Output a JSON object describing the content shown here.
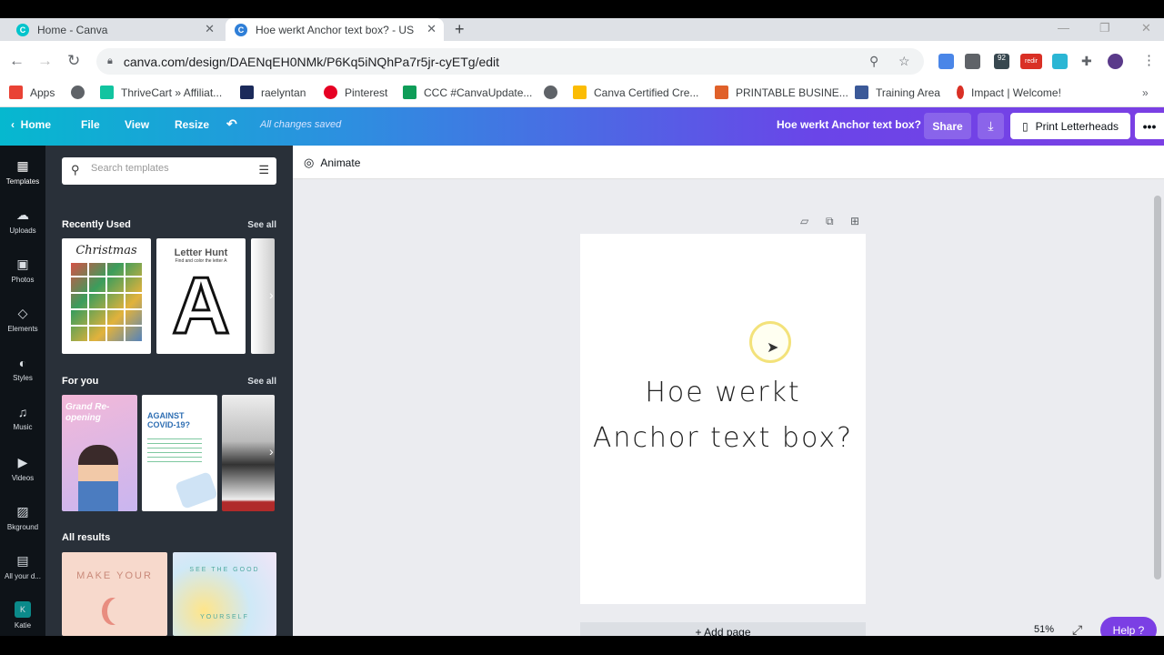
{
  "browser": {
    "tabs": [
      {
        "label": "Home - Canva",
        "active": false
      },
      {
        "label": "Hoe werkt Anchor text box? - US",
        "active": true
      }
    ],
    "url": "canva.com/design/DAENqEH0NMk/P6Kq5iNQhPa7r5jr-cyETg/edit",
    "ext_badge": "92",
    "ext_redir": "redir"
  },
  "bookmarks": [
    {
      "label": "Apps",
      "icon": "apps-grid-icon",
      "color": "#e94235"
    },
    {
      "label": "",
      "icon": "globe-icon",
      "color": "#5f6368"
    },
    {
      "label": "ThriveCart » Affiliat...",
      "icon": "thrivecart-icon",
      "color": "#12c4a0"
    },
    {
      "label": "raelyntan",
      "icon": "raelyntan-icon",
      "color": "#1b2a5a"
    },
    {
      "label": "Pinterest",
      "icon": "pinterest-icon",
      "color": "#e60023"
    },
    {
      "label": "CCC #CanvaUpdate...",
      "icon": "sheets-icon",
      "color": "#0f9d58"
    },
    {
      "label": "",
      "icon": "globe-icon",
      "color": "#5f6368"
    },
    {
      "label": "Canva Certified Cre...",
      "icon": "drive-icon",
      "color": "#fbbc04"
    },
    {
      "label": "PRINTABLE BUSINE...",
      "icon": "printable-icon",
      "color": "#e0612a"
    },
    {
      "label": "Training Area",
      "icon": "training-icon",
      "color": "#3b5998"
    },
    {
      "label": "Impact | Welcome!",
      "icon": "impact-icon",
      "color": "#d93025"
    }
  ],
  "canva_top": {
    "home": "Home",
    "file": "File",
    "view": "View",
    "resize": "Resize",
    "saved": "All changes saved",
    "design_title": "Hoe werkt Anchor text box?",
    "share": "Share",
    "print": "Print Letterheads",
    "more": "•••"
  },
  "rail": [
    {
      "label": "Templates",
      "icon": "templates-icon",
      "glyph": "▦"
    },
    {
      "label": "Uploads",
      "icon": "upload-cloud-icon",
      "glyph": "☁"
    },
    {
      "label": "Photos",
      "icon": "photos-icon",
      "glyph": "▣"
    },
    {
      "label": "Elements",
      "icon": "elements-icon",
      "glyph": "◇"
    },
    {
      "label": "Styles",
      "icon": "styles-palette-icon",
      "glyph": "◐"
    },
    {
      "label": "Music",
      "icon": "music-note-icon",
      "glyph": "♫"
    },
    {
      "label": "Videos",
      "icon": "video-icon",
      "glyph": "▶"
    },
    {
      "label": "Bkground",
      "icon": "background-icon",
      "glyph": "▨"
    },
    {
      "label": "All your d...",
      "icon": "folder-icon",
      "glyph": "▤"
    },
    {
      "label": "Katie",
      "icon": "avatar-icon",
      "glyph": "K"
    }
  ],
  "panel": {
    "search_placeholder": "Search templates",
    "recently_used": "Recently Used",
    "for_you": "For you",
    "all_results": "All results",
    "see_all": "See all",
    "thumb_christmas": "Christmas",
    "thumb_letter_hunt": "Letter Hunt",
    "thumb_letter_hunt_sub": "Find and color the letter A",
    "thumb_letter": "A",
    "thumb_grand": "Grand Re-opening",
    "thumb_covid": "AGAINST COVID-19?",
    "thumb_make_your": "MAKE YOUR",
    "thumb_see_good": "SEE THE GOOD",
    "thumb_yourself": "YOURSELF"
  },
  "editor": {
    "animate": "Animate",
    "page_text_line1": "Hoe werkt",
    "page_text_line2": "Anchor text box?",
    "add_page": "+ Add page",
    "zoom": "51%",
    "help": "Help ?"
  }
}
